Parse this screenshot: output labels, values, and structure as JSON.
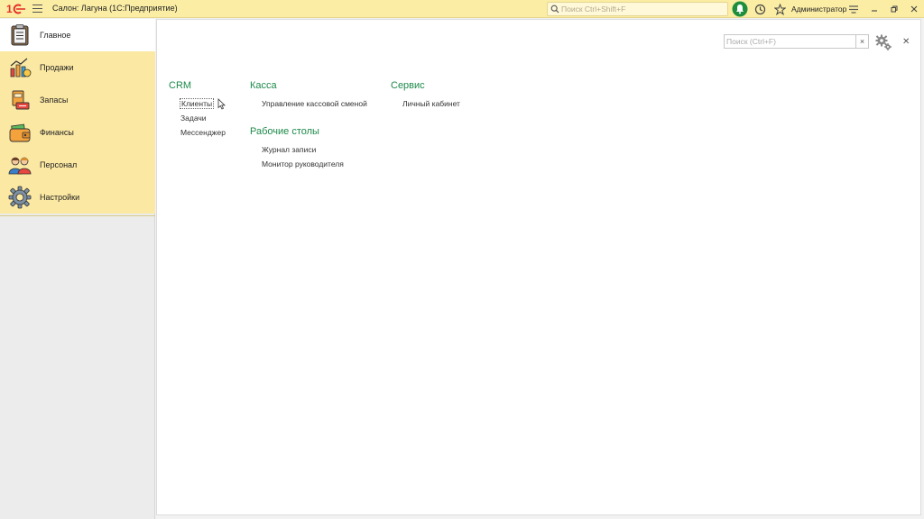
{
  "window": {
    "title": "Салон: Лагуна  (1С:Предприятие)",
    "search_placeholder": "Поиск Ctrl+Shift+F",
    "user": "Администратор"
  },
  "sidebar": {
    "items": [
      {
        "label": "Главное",
        "icon": "clipboard-icon",
        "active": true
      },
      {
        "label": "Продажи",
        "icon": "sales-chart-icon"
      },
      {
        "label": "Запасы",
        "icon": "inventory-icon"
      },
      {
        "label": "Финансы",
        "icon": "wallet-icon"
      },
      {
        "label": "Персонал",
        "icon": "staff-icon"
      },
      {
        "label": "Настройки",
        "icon": "gear-icon"
      }
    ]
  },
  "main": {
    "search_placeholder": "Поиск (Ctrl+F)",
    "sections": {
      "crm": {
        "title": "CRM",
        "links": [
          "Клиенты",
          "Задачи",
          "Мессенджер"
        ]
      },
      "kassa": {
        "title": "Касса",
        "links": [
          "Управление кассовой сменой"
        ]
      },
      "desktops": {
        "title": "Рабочие столы",
        "links": [
          "Журнал записи",
          "Монитор руководителя"
        ]
      },
      "service": {
        "title": "Сервис",
        "links": [
          "Личный кабинет"
        ]
      }
    }
  },
  "colors": {
    "topbar": "#fbeda4",
    "sidebar_item": "#fbe8a3",
    "section_title": "#1d8a4a",
    "logo": "#e5302b"
  }
}
